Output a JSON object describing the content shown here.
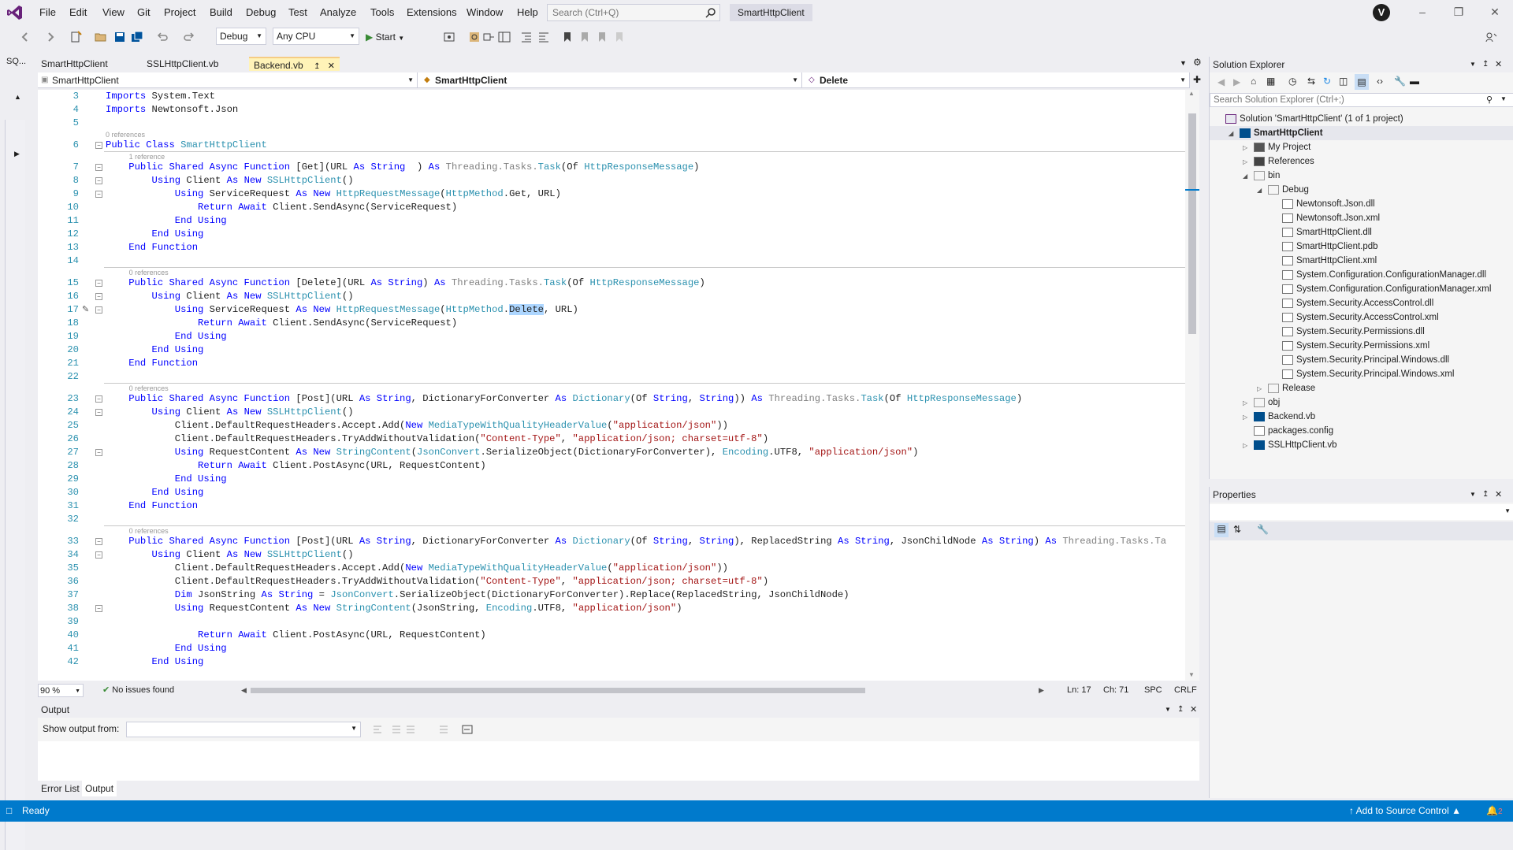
{
  "menu": [
    "File",
    "Edit",
    "View",
    "Git",
    "Project",
    "Build",
    "Debug",
    "Test",
    "Analyze",
    "Tools",
    "Extensions",
    "Window",
    "Help"
  ],
  "search": {
    "placeholder": "Search (Ctrl+Q)"
  },
  "project_name": "SmartHttpClient",
  "user_initial": "V",
  "toolbar": {
    "config": "Debug",
    "platform": "Any CPU",
    "start": "Start"
  },
  "left_strip": {
    "label": "SQ..."
  },
  "tabs": [
    {
      "label": "SmartHttpClient",
      "active": false
    },
    {
      "label": "SSLHttpClient.vb",
      "active": false
    },
    {
      "label": "Backend.vb",
      "active": true
    }
  ],
  "nav": {
    "project": "SmartHttpClient",
    "class": "SmartHttpClient",
    "member": "Delete"
  },
  "code_lines": [
    {
      "n": "3",
      "parts": [
        [
          "kw",
          "Imports"
        ],
        [
          "",
          "System.Text"
        ]
      ]
    },
    {
      "n": "4",
      "parts": [
        [
          "kw",
          "Imports"
        ],
        [
          "",
          "Newtonsoft.Json"
        ]
      ]
    },
    {
      "n": "5",
      "parts": []
    },
    {
      "n": "6",
      "refs": "0 references",
      "parts": [
        [
          "kw",
          "Public Class"
        ],
        [
          "ty",
          "SmartHttpClient"
        ]
      ]
    },
    {
      "n": "7",
      "refs": "1 reference",
      "parts": [
        [
          "kw",
          "    Public Shared Async Function"
        ],
        [
          "",
          "[Get](URL"
        ],
        [
          "kw",
          "As String"
        ],
        [
          "",
          " )"
        ],
        [
          "kw",
          "As"
        ],
        [
          "gr",
          "Threading.Tasks."
        ],
        [
          "ty",
          "Task"
        ],
        [
          "",
          "(Of"
        ],
        [
          "ty",
          "HttpResponseMessage"
        ],
        [
          "",
          ")"
        ]
      ]
    },
    {
      "n": "8",
      "parts": [
        [
          "kw",
          "        Using"
        ],
        [
          "",
          "Client"
        ],
        [
          "kw",
          "As New"
        ],
        [
          "ty",
          "SSLHttpClient"
        ],
        [
          "",
          "()"
        ]
      ]
    },
    {
      "n": "9",
      "parts": [
        [
          "kw",
          "            Using"
        ],
        [
          "",
          "ServiceRequest"
        ],
        [
          "kw",
          "As New"
        ],
        [
          "ty",
          "HttpRequestMessage"
        ],
        [
          "",
          "("
        ],
        [
          "ty",
          "HttpMethod"
        ],
        [
          "",
          ".Get, URL)"
        ]
      ]
    },
    {
      "n": "10",
      "parts": [
        [
          "kw",
          "                Return Await"
        ],
        [
          "",
          "Client.SendAsync(ServiceRequest)"
        ]
      ]
    },
    {
      "n": "11",
      "parts": [
        [
          "kw",
          "            End Using"
        ]
      ]
    },
    {
      "n": "12",
      "parts": [
        [
          "kw",
          "        End Using"
        ]
      ]
    },
    {
      "n": "13",
      "parts": [
        [
          "kw",
          "    End Function"
        ]
      ]
    },
    {
      "n": "14",
      "parts": []
    },
    {
      "n": "15",
      "refs": "0 references",
      "parts": [
        [
          "kw",
          "    Public Shared Async Function"
        ],
        [
          "",
          "[Delete](URL"
        ],
        [
          "kw",
          "As String"
        ],
        [
          "",
          ")"
        ],
        [
          "kw",
          "As"
        ],
        [
          "gr",
          "Threading.Tasks."
        ],
        [
          "ty",
          "Task"
        ],
        [
          "",
          "(Of"
        ],
        [
          "ty",
          "HttpResponseMessage"
        ],
        [
          "",
          ")"
        ]
      ]
    },
    {
      "n": "16",
      "parts": [
        [
          "kw",
          "        Using"
        ],
        [
          "",
          "Client"
        ],
        [
          "kw",
          "As New"
        ],
        [
          "ty",
          "SSLHttpClient"
        ],
        [
          "",
          "()"
        ]
      ]
    },
    {
      "n": "17",
      "parts": [
        [
          "kw",
          "            Using"
        ],
        [
          "",
          "ServiceRequest"
        ],
        [
          "kw",
          "As New"
        ],
        [
          "ty",
          "HttpRequestMessage"
        ],
        [
          "",
          "("
        ],
        [
          "ty",
          "HttpMethod"
        ],
        [
          "",
          "."
        ],
        [
          "sel",
          "Delete"
        ],
        [
          "",
          ", URL)"
        ]
      ]
    },
    {
      "n": "18",
      "parts": [
        [
          "kw",
          "                Return Await"
        ],
        [
          "",
          "Client.SendAsync(ServiceRequest)"
        ]
      ]
    },
    {
      "n": "19",
      "parts": [
        [
          "kw",
          "            End Using"
        ]
      ]
    },
    {
      "n": "20",
      "parts": [
        [
          "kw",
          "        End Using"
        ]
      ]
    },
    {
      "n": "21",
      "parts": [
        [
          "kw",
          "    End Function"
        ]
      ]
    },
    {
      "n": "22",
      "parts": []
    },
    {
      "n": "23",
      "refs": "0 references",
      "parts": [
        [
          "kw",
          "    Public Shared Async Function"
        ],
        [
          "",
          "[Post](URL"
        ],
        [
          "kw",
          "As String"
        ],
        [
          "",
          ", DictionaryForConverter"
        ],
        [
          "kw",
          "As"
        ],
        [
          "ty",
          "Dictionary"
        ],
        [
          "",
          "(Of"
        ],
        [
          "kw",
          "String"
        ],
        [
          "",
          ","
        ],
        [
          "kw",
          "String"
        ],
        [
          "",
          "))"
        ],
        [
          "kw",
          "As"
        ],
        [
          "gr",
          "Threading.Tasks."
        ],
        [
          "ty",
          "Task"
        ],
        [
          "",
          "(Of"
        ],
        [
          "ty",
          "HttpResponseMessage"
        ],
        [
          "",
          ")"
        ]
      ]
    },
    {
      "n": "24",
      "parts": [
        [
          "kw",
          "        Using"
        ],
        [
          "",
          "Client"
        ],
        [
          "kw",
          "As New"
        ],
        [
          "ty",
          "SSLHttpClient"
        ],
        [
          "",
          "()"
        ]
      ]
    },
    {
      "n": "25",
      "parts": [
        [
          "",
          "            Client.DefaultRequestHeaders.Accept.Add("
        ],
        [
          "kw",
          "New"
        ],
        [
          "ty",
          "MediaTypeWithQualityHeaderValue"
        ],
        [
          "",
          "("
        ],
        [
          "str",
          "\"application/json\""
        ],
        [
          "",
          "))"
        ]
      ]
    },
    {
      "n": "26",
      "parts": [
        [
          "",
          "            Client.DefaultRequestHeaders.TryAddWithoutValidation("
        ],
        [
          "str",
          "\"Content-Type\""
        ],
        [
          "",
          ","
        ],
        [
          "str",
          "\"application/json; charset=utf-8\""
        ],
        [
          "",
          ")"
        ]
      ]
    },
    {
      "n": "27",
      "parts": [
        [
          "kw",
          "            Using"
        ],
        [
          "",
          "RequestContent"
        ],
        [
          "kw",
          "As New"
        ],
        [
          "ty",
          "StringContent"
        ],
        [
          "",
          "("
        ],
        [
          "ty",
          "JsonConvert"
        ],
        [
          "",
          ".SerializeObject(DictionaryForConverter),"
        ],
        [
          "ty",
          "Encoding"
        ],
        [
          "",
          ".UTF8,"
        ],
        [
          "str",
          "\"application/json\""
        ],
        [
          "",
          ")"
        ]
      ]
    },
    {
      "n": "28",
      "parts": [
        [
          "kw",
          "                Return Await"
        ],
        [
          "",
          "Client.PostAsync(URL, RequestContent)"
        ]
      ]
    },
    {
      "n": "29",
      "parts": [
        [
          "kw",
          "            End Using"
        ]
      ]
    },
    {
      "n": "30",
      "parts": [
        [
          "kw",
          "        End Using"
        ]
      ]
    },
    {
      "n": "31",
      "parts": [
        [
          "kw",
          "    End Function"
        ]
      ]
    },
    {
      "n": "32",
      "parts": []
    },
    {
      "n": "33",
      "refs": "0 references",
      "parts": [
        [
          "kw",
          "    Public Shared Async Function"
        ],
        [
          "",
          "[Post](URL"
        ],
        [
          "kw",
          "As String"
        ],
        [
          "",
          ", DictionaryForConverter"
        ],
        [
          "kw",
          "As"
        ],
        [
          "ty",
          "Dictionary"
        ],
        [
          "",
          "(Of"
        ],
        [
          "kw",
          "String"
        ],
        [
          "",
          ","
        ],
        [
          "kw",
          "String"
        ],
        [
          "",
          "), ReplacedString"
        ],
        [
          "kw",
          "As String"
        ],
        [
          "",
          ", JsonChildNode"
        ],
        [
          "kw",
          "As String"
        ],
        [
          "",
          ")"
        ],
        [
          "kw",
          "As"
        ],
        [
          "gr",
          "Threading.Tasks.Ta"
        ]
      ]
    },
    {
      "n": "34",
      "parts": [
        [
          "kw",
          "        Using"
        ],
        [
          "",
          "Client"
        ],
        [
          "kw",
          "As New"
        ],
        [
          "ty",
          "SSLHttpClient"
        ],
        [
          "",
          "()"
        ]
      ]
    },
    {
      "n": "35",
      "parts": [
        [
          "",
          "            Client.DefaultRequestHeaders.Accept.Add("
        ],
        [
          "kw",
          "New"
        ],
        [
          "ty",
          "MediaTypeWithQualityHeaderValue"
        ],
        [
          "",
          "("
        ],
        [
          "str",
          "\"application/json\""
        ],
        [
          "",
          "))"
        ]
      ]
    },
    {
      "n": "36",
      "parts": [
        [
          "",
          "            Client.DefaultRequestHeaders.TryAddWithoutValidation("
        ],
        [
          "str",
          "\"Content-Type\""
        ],
        [
          "",
          ","
        ],
        [
          "str",
          "\"application/json; charset=utf-8\""
        ],
        [
          "",
          ")"
        ]
      ]
    },
    {
      "n": "37",
      "parts": [
        [
          "kw",
          "            Dim"
        ],
        [
          "",
          "JsonString"
        ],
        [
          "kw",
          "As String"
        ],
        [
          "",
          "="
        ],
        [
          "ty",
          "JsonConvert"
        ],
        [
          "",
          ".SerializeObject(DictionaryForConverter).Replace(ReplacedString, JsonChildNode)"
        ]
      ]
    },
    {
      "n": "38",
      "parts": [
        [
          "kw",
          "            Using"
        ],
        [
          "",
          "RequestContent"
        ],
        [
          "kw",
          "As New"
        ],
        [
          "ty",
          "StringContent"
        ],
        [
          "",
          "(JsonString,"
        ],
        [
          "ty",
          "Encoding"
        ],
        [
          "",
          ".UTF8,"
        ],
        [
          "str",
          "\"application/json\""
        ],
        [
          "",
          ")"
        ]
      ]
    },
    {
      "n": "39",
      "parts": []
    },
    {
      "n": "40",
      "parts": [
        [
          "kw",
          "                Return Await"
        ],
        [
          "",
          "Client.PostAsync(URL, RequestContent)"
        ]
      ]
    },
    {
      "n": "41",
      "parts": [
        [
          "kw",
          "            End Using"
        ]
      ]
    },
    {
      "n": "42",
      "parts": [
        [
          "kw",
          "        End Using"
        ]
      ]
    }
  ],
  "editor_status": {
    "zoom": "90 %",
    "issues": "No issues found",
    "line": "Ln: 17",
    "col": "Ch: 71",
    "spc": "SPC",
    "eol": "CRLF"
  },
  "output": {
    "title": "Output",
    "show_from": "Show output from:"
  },
  "bottom_tabs": [
    "Error List",
    "Output"
  ],
  "solution_explorer": {
    "title": "Solution Explorer",
    "search_placeholder": "Search Solution Explorer (Ctrl+;)",
    "items": [
      {
        "label": "Solution 'SmartHttpClient' (1 of 1 project)",
        "level": 0,
        "tri": ""
      },
      {
        "label": "SmartHttpClient",
        "level": 1,
        "tri": "open",
        "bold": true
      },
      {
        "label": "My Project",
        "level": 2,
        "tri": "closed"
      },
      {
        "label": "References",
        "level": 2,
        "tri": "closed"
      },
      {
        "label": "bin",
        "level": 2,
        "tri": "open"
      },
      {
        "label": "Debug",
        "level": 3,
        "tri": "open"
      },
      {
        "label": "Newtonsoft.Json.dll",
        "level": 4,
        "tri": ""
      },
      {
        "label": "Newtonsoft.Json.xml",
        "level": 4,
        "tri": ""
      },
      {
        "label": "SmartHttpClient.dll",
        "level": 4,
        "tri": ""
      },
      {
        "label": "SmartHttpClient.pdb",
        "level": 4,
        "tri": ""
      },
      {
        "label": "SmartHttpClient.xml",
        "level": 4,
        "tri": ""
      },
      {
        "label": "System.Configuration.ConfigurationManager.dll",
        "level": 4,
        "tri": ""
      },
      {
        "label": "System.Configuration.ConfigurationManager.xml",
        "level": 4,
        "tri": ""
      },
      {
        "label": "System.Security.AccessControl.dll",
        "level": 4,
        "tri": ""
      },
      {
        "label": "System.Security.AccessControl.xml",
        "level": 4,
        "tri": ""
      },
      {
        "label": "System.Security.Permissions.dll",
        "level": 4,
        "tri": ""
      },
      {
        "label": "System.Security.Permissions.xml",
        "level": 4,
        "tri": ""
      },
      {
        "label": "System.Security.Principal.Windows.dll",
        "level": 4,
        "tri": ""
      },
      {
        "label": "System.Security.Principal.Windows.xml",
        "level": 4,
        "tri": ""
      },
      {
        "label": "Release",
        "level": 3,
        "tri": "closed"
      },
      {
        "label": "obj",
        "level": 2,
        "tri": "closed"
      },
      {
        "label": "Backend.vb",
        "level": 2,
        "tri": "closed"
      },
      {
        "label": "packages.config",
        "level": 2,
        "tri": ""
      },
      {
        "label": "SSLHttpClient.vb",
        "level": 2,
        "tri": "closed"
      }
    ]
  },
  "properties": {
    "title": "Properties"
  },
  "statusbar": {
    "ready": "Ready",
    "source_control": "Add to Source Control",
    "notifications": "2"
  },
  "colors": {
    "accent": "#007acc",
    "keyword": "#0000ff",
    "type": "#2b91af",
    "string": "#a31515"
  }
}
